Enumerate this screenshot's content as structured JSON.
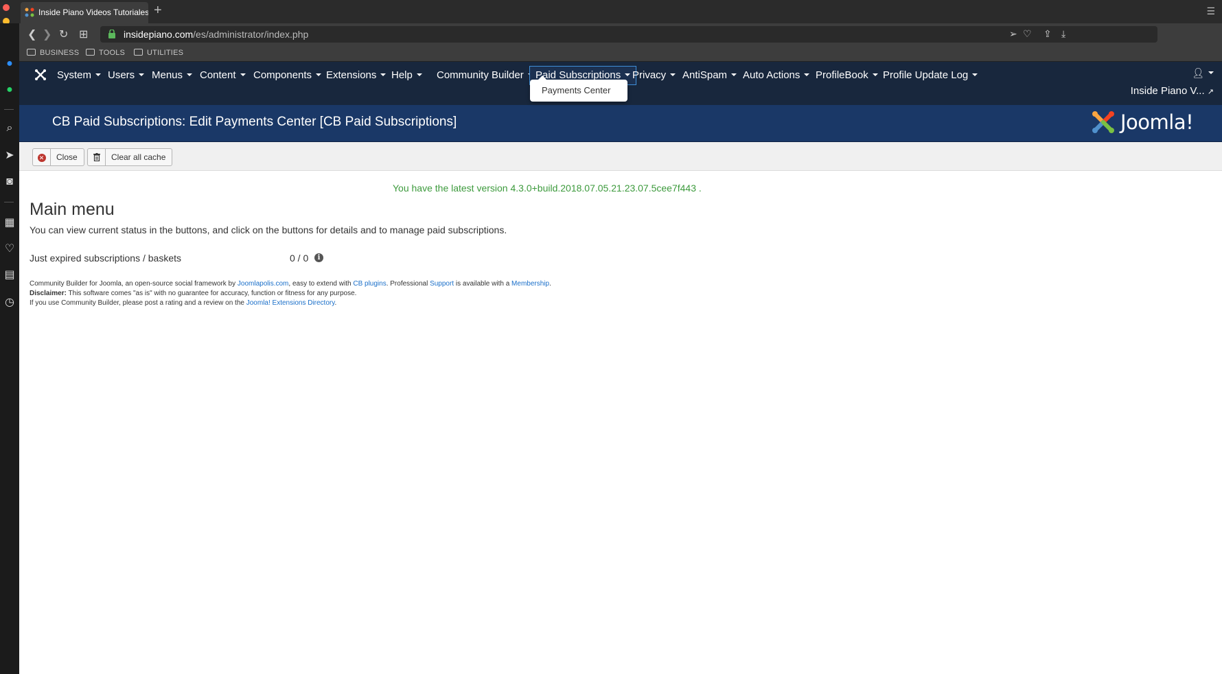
{
  "browser": {
    "tab_title": "Inside Piano Videos Tutoriales",
    "url_host": "insidepiano.com",
    "url_path": "/es/administrator/index.php",
    "bookmarks": [
      "BUSINESS",
      "TOOLS",
      "UTILITIES"
    ]
  },
  "nav": {
    "items": [
      {
        "label": "System"
      },
      {
        "label": "Users"
      },
      {
        "label": "Menus"
      },
      {
        "label": "Content"
      },
      {
        "label": "Components"
      },
      {
        "label": "Extensions"
      },
      {
        "label": "Help"
      },
      {
        "label": "Community Builder"
      },
      {
        "label": "Paid Subscriptions"
      },
      {
        "label": "Privacy"
      },
      {
        "label": "AntiSpam"
      },
      {
        "label": "Auto Actions"
      },
      {
        "label": "ProfileBook"
      },
      {
        "label": "Profile Update Log"
      }
    ],
    "active": "Paid Subscriptions",
    "dropdown_item": "Payments Center",
    "site_link": "Inside Piano V..."
  },
  "header": {
    "title": "CB Paid Subscriptions: Edit Payments Center [CB Paid Subscriptions]",
    "logo_text": "Joomla!"
  },
  "toolbar": {
    "close_label": "Close",
    "clear_cache_label": "Clear all cache"
  },
  "content": {
    "version_message": "You have the latest version 4.3.0+build.2018.07.05.21.23.07.5cee7f443 .",
    "title": "Main menu",
    "description": "You can view current status in the buttons, and click on the buttons for details and to manage paid subscriptions.",
    "expired_label": "Just expired subscriptions / baskets",
    "expired_value": "0 / 0"
  },
  "footer": {
    "line1_a": "Community Builder for Joomla, an open-source social framework by ",
    "link_joomlapolis": "Joomlapolis.com",
    "line1_b": ", easy to extend with ",
    "link_cb_plugins": "CB plugins",
    "line1_c": ". Professional ",
    "link_support": "Support",
    "line1_d": " is available with a ",
    "link_membership": "Membership",
    "line1_e": ".",
    "disclaimer_label": "Disclaimer:",
    "disclaimer_text": " This software comes \"as is\" with no guarantee for accuracy, function or fitness for any purpose.",
    "line3_a": "If you use Community Builder, please post a rating and a review on the ",
    "link_jed": "Joomla! Extensions Directory",
    "line3_b": "."
  },
  "colors": {
    "nav_bg": "#18273d",
    "header_bg": "#1a3867",
    "version_green": "#3c9a3c",
    "link_blue": "#1a6fc9"
  }
}
